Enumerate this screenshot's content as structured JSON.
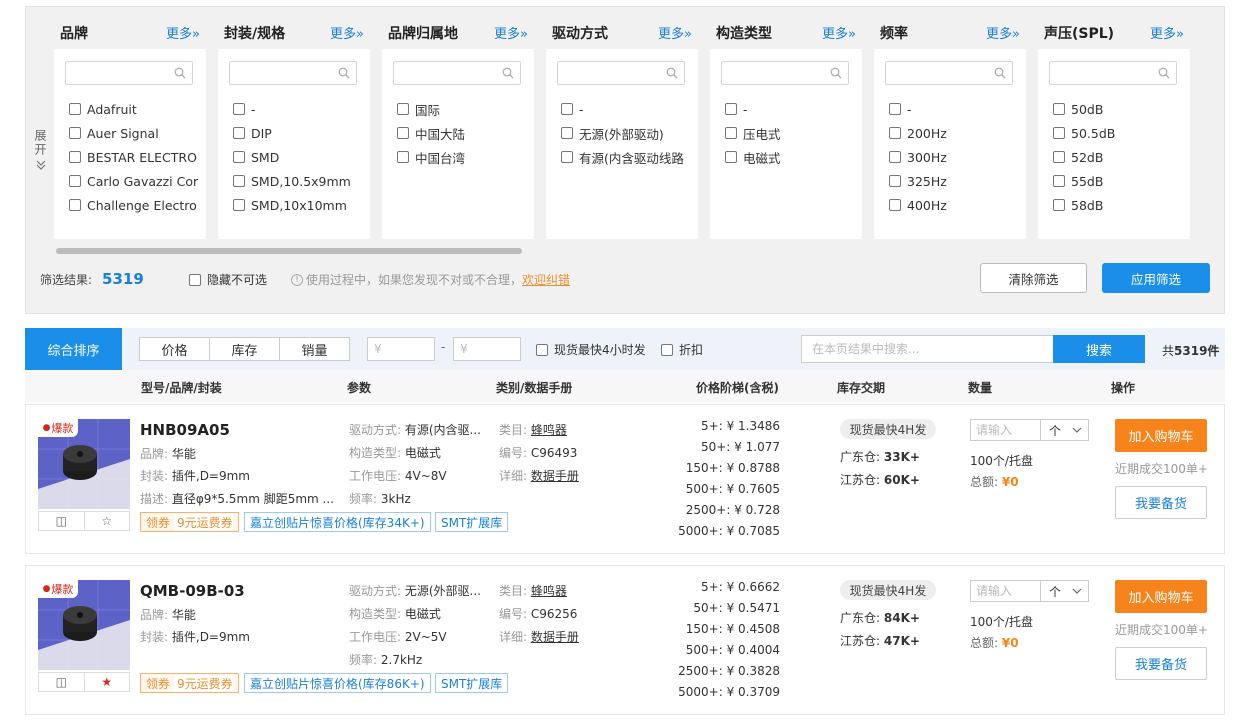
{
  "filters": {
    "expand_label": "展开",
    "facets": [
      {
        "title": "品牌",
        "more": "更多»",
        "options": [
          "Adafruit",
          "Auer Signal",
          "BESTAR ELECTRO",
          "Carlo Gavazzi Cor",
          "Challenge Electro"
        ]
      },
      {
        "title": "封装/规格",
        "more": "更多»",
        "options": [
          "-",
          "DIP",
          "SMD",
          "SMD,10.5x9mm",
          "SMD,10x10mm"
        ]
      },
      {
        "title": "品牌归属地",
        "more": "更多»",
        "options": [
          "国际",
          "中国大陆",
          "中国台湾"
        ]
      },
      {
        "title": "驱动方式",
        "more": "更多»",
        "options": [
          "-",
          "无源(外部驱动)",
          "有源(内含驱动线路"
        ]
      },
      {
        "title": "构造类型",
        "more": "更多»",
        "options": [
          "-",
          "压电式",
          "电磁式"
        ]
      },
      {
        "title": "频率",
        "more": "更多»",
        "options": [
          "-",
          "200Hz",
          "300Hz",
          "325Hz",
          "400Hz"
        ]
      },
      {
        "title": "声压(SPL)",
        "more": "更多»",
        "options": [
          "50dB",
          "50.5dB",
          "52dB",
          "55dB",
          "58dB"
        ]
      }
    ],
    "result_label": "筛选结果:",
    "result_count": "5319",
    "hide_unavailable": "隐藏不可选",
    "tip_text": "使用过程中，如果您发现不对或不合理，",
    "tip_link": "欢迎纠错",
    "clear_label": "清除筛选",
    "apply_label": "应用筛选"
  },
  "sortbar": {
    "active": "综合排序",
    "sorts": [
      "价格",
      "库存",
      "销量"
    ],
    "price_min_placeholder": "¥",
    "price_max_placeholder": "¥",
    "dash": "-",
    "in_stock_4h": "现货最快4小时发",
    "discount": "折扣",
    "search_placeholder": "在本页结果中搜索...",
    "search_label": "搜索",
    "total_prefix": "共",
    "total_count": "5319",
    "total_suffix": "件"
  },
  "columns": {
    "model": "型号/品牌/封装",
    "params": "参数",
    "category": "类别/数据手册",
    "price": "价格阶梯(含税)",
    "stock": "库存交期",
    "qty": "数量",
    "action": "操作"
  },
  "products": [
    {
      "hot": "爆款",
      "name": "HNB09A05",
      "brand_label": "品牌:",
      "brand": "华能",
      "pkg_label": "封装:",
      "pkg": "插件,D=9mm",
      "desc_label": "描述:",
      "desc": "直径φ9*5.5mm 脚距5mm ...",
      "params": [
        {
          "label": "驱动方式:",
          "value": "有源(内含驱..."
        },
        {
          "label": "构造类型:",
          "value": "电磁式"
        },
        {
          "label": "工作电压:",
          "value": "4V~8V"
        },
        {
          "label": "频率:",
          "value": "3kHz"
        }
      ],
      "cat_label": "类目:",
      "category": "蜂鸣器",
      "code_label": "编号:",
      "code": "C96493",
      "detail_label": "详细:",
      "datasheet": "数据手册",
      "coupon": "领券",
      "coupon_sub": "9元运费券",
      "promo": "嘉立创贴片惊喜价格(库存34K+)",
      "smt": "SMT扩展库",
      "prices": [
        [
          "5+:",
          "¥ 1.3486"
        ],
        [
          "50+:",
          "¥ 1.077"
        ],
        [
          "150+:",
          "¥ 0.8788"
        ],
        [
          "500+:",
          "¥ 0.7605"
        ],
        [
          "2500+:",
          "¥ 0.728"
        ],
        [
          "5000+:",
          "¥ 0.7085"
        ]
      ],
      "stock_badge": "现货最快4H发",
      "wh1_label": "广东仓:",
      "wh1": "33K+",
      "wh2_label": "江苏仓:",
      "wh2": "60K+",
      "qty_placeholder": "请输入",
      "unit": "个",
      "pack": "100个/托盘",
      "total_label": "总额:",
      "total": "¥0",
      "cart": "加入购物车",
      "recent": "近期成交100单+",
      "stockup": "我要备货",
      "favorited": false
    },
    {
      "hot": "爆款",
      "name": "QMB-09B-03",
      "brand_label": "品牌:",
      "brand": "华能",
      "pkg_label": "封装:",
      "pkg": "插件,D=9mm",
      "params": [
        {
          "label": "驱动方式:",
          "value": "无源(外部驱..."
        },
        {
          "label": "构造类型:",
          "value": "电磁式"
        },
        {
          "label": "工作电压:",
          "value": "2V~5V"
        },
        {
          "label": "频率:",
          "value": "2.7kHz"
        }
      ],
      "cat_label": "类目:",
      "category": "蜂鸣器",
      "code_label": "编号:",
      "code": "C96256",
      "detail_label": "详细:",
      "datasheet": "数据手册",
      "coupon": "领券",
      "coupon_sub": "9元运费券",
      "promo": "嘉立创贴片惊喜价格(库存86K+)",
      "smt": "SMT扩展库",
      "prices": [
        [
          "5+:",
          "¥ 0.6662"
        ],
        [
          "50+:",
          "¥ 0.5471"
        ],
        [
          "150+:",
          "¥ 0.4508"
        ],
        [
          "500+:",
          "¥ 0.4004"
        ],
        [
          "2500+:",
          "¥ 0.3828"
        ],
        [
          "5000+:",
          "¥ 0.3709"
        ]
      ],
      "stock_badge": "现货最快4H发",
      "wh1_label": "广东仓:",
      "wh1": "84K+",
      "wh2_label": "江苏仓:",
      "wh2": "47K+",
      "qty_placeholder": "请输入",
      "unit": "个",
      "pack": "100个/托盘",
      "total_label": "总额:",
      "total": "¥0",
      "cart": "加入购物车",
      "recent": "近期成交100单+",
      "stockup": "我要备货",
      "favorited": true
    }
  ],
  "colors": {
    "accent": "#1a8ee8",
    "orange": "#f6831c",
    "hot_red": "#d02a1e"
  }
}
